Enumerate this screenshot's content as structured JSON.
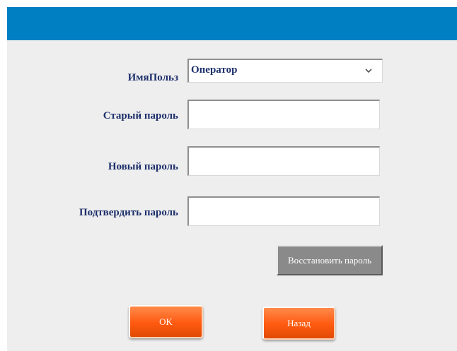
{
  "form": {
    "username_label": "ИмяПольз",
    "username_value": "Оператор",
    "old_password_label": "Старый пароль",
    "new_password_label": "Новый пароль",
    "confirm_password_label": "Подтвердить пароль",
    "old_password_value": "",
    "new_password_value": "",
    "confirm_password_value": ""
  },
  "buttons": {
    "restore_label": "Восстановить пароль",
    "ok_label": "OK",
    "back_label": "Назад"
  },
  "colors": {
    "titlebar": "#007fc3",
    "panel": "#eeeeee",
    "label_text": "#1c2e6a",
    "orange_button": "#ff5a10",
    "gray_button": "#8a8a8a"
  },
  "icons": {
    "dropdown": "chevron-down-icon"
  }
}
